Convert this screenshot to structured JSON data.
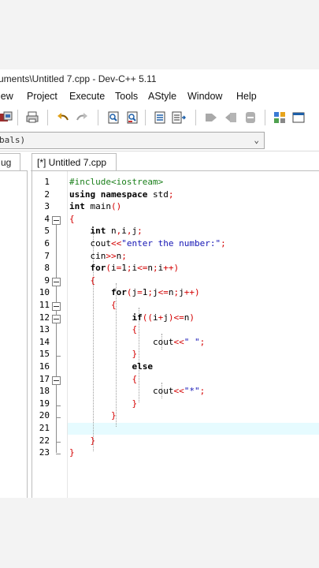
{
  "window": {
    "title": "uments\\Untitled 7.cpp - Dev-C++ 5.11"
  },
  "menu": [
    "iew",
    "Project",
    "Execute",
    "Tools",
    "AStyle",
    "Window",
    "Help"
  ],
  "toolbar": {
    "icons": [
      "compile-project-icon",
      "print-icon",
      "undo-icon",
      "redo-icon",
      "find-icon",
      "replace-icon",
      "goto-line-icon",
      "indent-icon",
      "compile-gray-icon",
      "run-gray-icon",
      "debug-gray-icon",
      "layout-icon",
      "window-icon"
    ]
  },
  "scope_combo": {
    "value": "bals)"
  },
  "left_tab": {
    "label": "ug"
  },
  "editor_tab": {
    "label": "[*] Untitled 7.cpp"
  },
  "editor": {
    "line_numbers": [
      "1",
      "2",
      "3",
      "4",
      "5",
      "6",
      "7",
      "8",
      "9",
      "10",
      "11",
      "12",
      "13",
      "14",
      "15",
      "16",
      "17",
      "18",
      "19",
      "20",
      "21",
      "22",
      "23"
    ],
    "highlighted_line": "21",
    "lines": [
      "#include<iostream>",
      "using namespace std;",
      "int main()",
      "{",
      "    int n,i,j;",
      "    cout<<\"enter the number:\";",
      "    cin>>n;",
      "    for(i=1;i<=n;i++)",
      "    {",
      "        for(j=1;j<=n;j++)",
      "        {",
      "            if((i+j)<=n)",
      "            {",
      "                cout<<\" \";",
      "            }",
      "            else",
      "            {",
      "                cout<<\"*\";",
      "            }",
      "        }",
      "",
      "    }",
      "}"
    ]
  },
  "colors": {
    "keyword": "#000000",
    "preprocessor": "#1a7f1a",
    "symbol": "#d40000",
    "string": "#1414b4",
    "current_line": "#e6fbff"
  }
}
